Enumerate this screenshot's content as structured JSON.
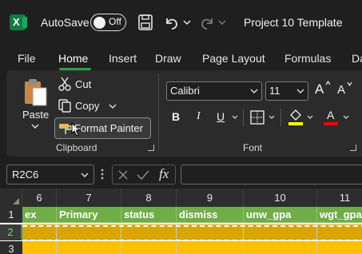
{
  "titlebar": {
    "app_letter": "X",
    "autosave_label": "AutoSave",
    "autosave_state": "Off",
    "document_title": "Project 10 Template"
  },
  "tabs": [
    {
      "label": "File"
    },
    {
      "label": "Home",
      "active": true
    },
    {
      "label": "Insert"
    },
    {
      "label": "Draw"
    },
    {
      "label": "Page Layout"
    },
    {
      "label": "Formulas"
    },
    {
      "label": "Da"
    }
  ],
  "clipboard": {
    "paste": "Paste",
    "cut": "Cut",
    "copy": "Copy",
    "format_painter": "Format Painter",
    "group_label": "Clipboard"
  },
  "font": {
    "family": "Calibri",
    "size": "11",
    "grow": "A",
    "shrink": "A",
    "bold": "B",
    "italic": "I",
    "underline": "U",
    "font_color_letter": "A",
    "group_label": "Font"
  },
  "formula_bar": {
    "name_box": "R2C6",
    "fx": "fx",
    "value": ""
  },
  "grid": {
    "columns": [
      "6",
      "7",
      "8",
      "9",
      "10",
      "11"
    ],
    "rows": [
      "1",
      "2",
      "3"
    ],
    "header_row": [
      "ex",
      "Primary",
      "status",
      "dismiss",
      "unw_gpa",
      "wgt_gpa"
    ]
  },
  "colors": {
    "accent": "#2ea043",
    "excel_green": "#107c41",
    "header_fill": "#70ad47",
    "row_fill": "#ffc000",
    "highlight_bar": "#ffff00",
    "font_color_bar": "#ff0000"
  }
}
